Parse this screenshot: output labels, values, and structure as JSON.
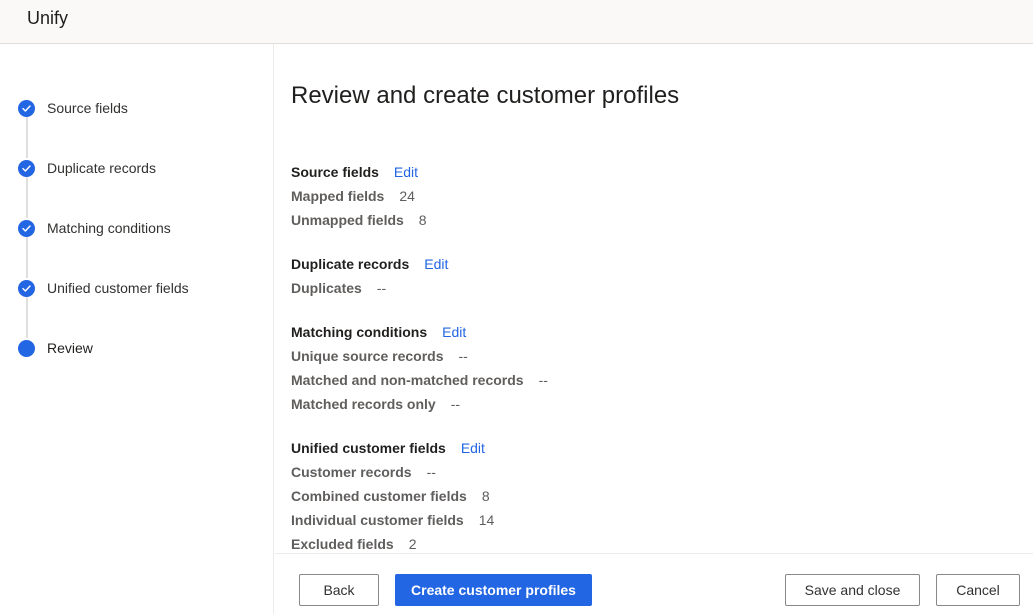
{
  "app": {
    "title": "Unify"
  },
  "sidebar": {
    "steps": [
      {
        "label": "Source fields",
        "state": "completed",
        "icon": "check-circle-icon"
      },
      {
        "label": "Duplicate records",
        "state": "completed",
        "icon": "check-circle-icon"
      },
      {
        "label": "Matching conditions",
        "state": "completed",
        "icon": "check-circle-icon"
      },
      {
        "label": "Unified customer fields",
        "state": "completed",
        "icon": "check-circle-icon"
      },
      {
        "label": "Review",
        "state": "current",
        "icon": "filled-circle-icon"
      }
    ]
  },
  "main": {
    "title": "Review and create customer profiles",
    "edit_label": "Edit",
    "sections": [
      {
        "title": "Source fields",
        "rows": [
          {
            "label": "Mapped fields",
            "value": "24"
          },
          {
            "label": "Unmapped fields",
            "value": "8"
          }
        ]
      },
      {
        "title": "Duplicate records",
        "rows": [
          {
            "label": "Duplicates",
            "value": "--"
          }
        ]
      },
      {
        "title": "Matching conditions",
        "rows": [
          {
            "label": "Unique source records",
            "value": "--"
          },
          {
            "label": "Matched and non-matched records",
            "value": "--"
          },
          {
            "label": "Matched records only",
            "value": "--"
          }
        ]
      },
      {
        "title": "Unified customer fields",
        "rows": [
          {
            "label": "Customer records",
            "value": "--"
          },
          {
            "label": "Combined customer fields",
            "value": "8"
          },
          {
            "label": "Individual customer fields",
            "value": "14"
          },
          {
            "label": "Excluded fields",
            "value": "2"
          }
        ]
      }
    ]
  },
  "footer": {
    "back_label": "Back",
    "create_label": "Create customer profiles",
    "save_close_label": "Save and close",
    "cancel_label": "Cancel"
  },
  "colors": {
    "accent": "#2266e3",
    "header_bg": "#faf9f8",
    "text_primary": "#201f1e",
    "text_secondary": "#605e5c"
  }
}
